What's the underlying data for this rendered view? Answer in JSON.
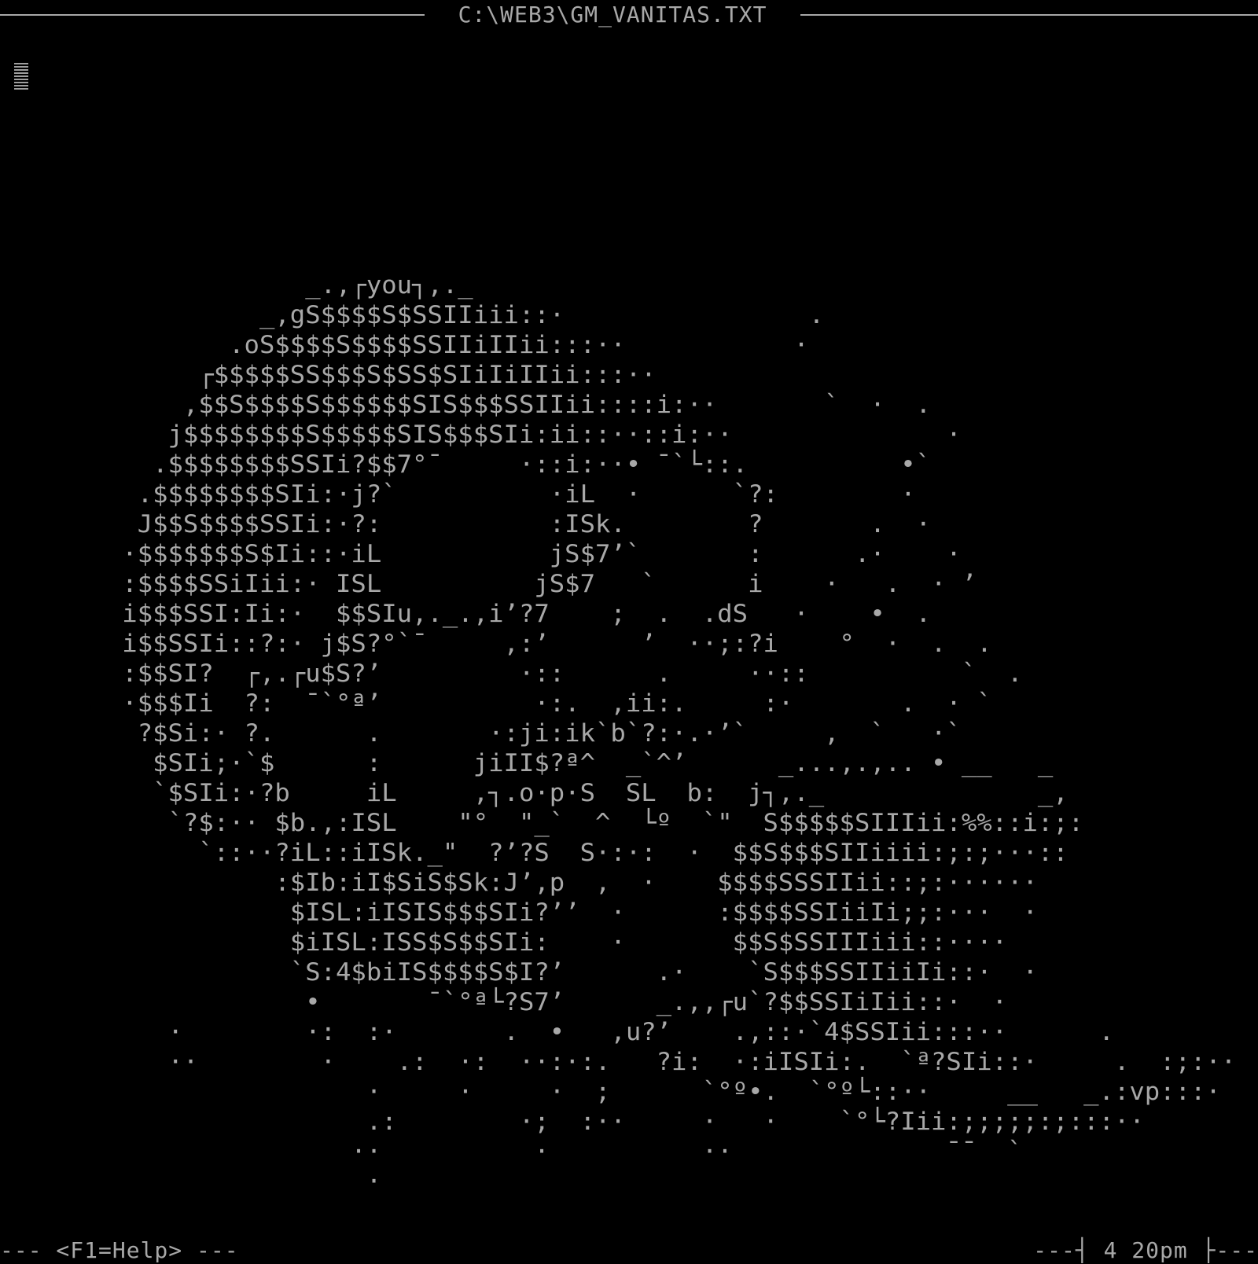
{
  "window": {
    "title": "C:\\WEB3\\GM_VANITAS.TXT"
  },
  "document": {
    "content": "                    _.,┌you┐,._\n                 _,gS$$$$S$SSIIiii::·                .\n               .oS$$$$S$$$$SSIIiIIii:::··           ·\n             ┌$$$$$SS$$$S$SS$SIiIiIIii:::··\n            ,$$S$$$$S$$$$$$SIS$$$SSIIii::::i:··       `  ·  .\n           j$$$$$$$$S$$$$$SIS$$$SIi:ii::··::i:··              ·\n          .$$$$$$$$SSIi?$$7°¯     ·::i:··• ¯`└::.          •`\n         .$$$$$$$$SIi:·j?`          ·iL  ·      `?:        ·\n         J$$S$$$$SSIi:·?:           :ISk.        ?       .  ·\n        ·$$$$$$$S$Ii::·iL           jS$7’`       :      .·    ·\n        :$$$$SSiIii:· ISL          jS$7   `      i    ·   .  · ’\n        i$$$SSI:Ii:·  $$SIu,._.,i’?7    ;  .  .dS   ·    •  .\n        i$$SSIi::?:· j$S?°`¯     ,:’      ’  ··;:?i    °  ·  .  .\n        :$$SI?  ┌,.┌u$S?’         ·::      .     ··::          `  .\n        ·$$$Ii  ?:  ¯`°ª’          ·:.  ,ii:.     :·       .  · `\n         ?$Si:· ?.      .       ·:ji:ik`b`?:·.·’`     ,  `   ·`\n          $SIi;·`$      :      jiII$?ª^  _`^’      _...,.,.. • __   _\n          `$SIi:·?b     iL     ,┐.o·p·S  SL  b:  j┐,._              _,\n           `?$:·· $b.,:ISL    \"°  \"_`  ^  └º  `\"  S$$$$$SIIIii:%%::i:;:\n             `::··?iL::iISk._\"  ?’?S  S·:·:  ·  $$S$$$SIIiiii:;:;···::\n                  :$Ib:iI$SiS$Sk:J’,p  ,  ·    $$$$SSSIIii::;:······\n                   $ISL:iISIS$$$SIi?’’  ·      :$$$$SSIiiIi;;:···  ·\n                   $iISL:ISS$S$$SIi:    ·       $$S$SSIIIiii::····\n                   `S:4$biIS$$$$S$I?’      .·    `S$$$SSIIiiIi::·  ·\n                    •       ¯`°ª└?S7’      _.,,┌u`?$$SSIiIii::·  ·\n           ·        ·:  :·       .  •   ,u?’    .,::·`4$SSIii:::··      .\n           ··        ·    .:  ·:  ··:·:.   ?i:  ·:iISIi:.  `ª?SIi::·     .  :;:··\n                        ·     ·     ·  ;      `°º•.  `°º└::··     __   _.:vp:::·\n                        .:        ·;  :··     ·   ·    `°└?Iii:;;;;;:;:::··\n                       ··          ·          ··              ¯¯  `\n                        ·"
  },
  "statusbar": {
    "help": "--- <F1=Help> ---",
    "clock": "---┤ 4 20pm ├---"
  },
  "colors": {
    "background": "#000000",
    "text": "#a8a8a8"
  }
}
